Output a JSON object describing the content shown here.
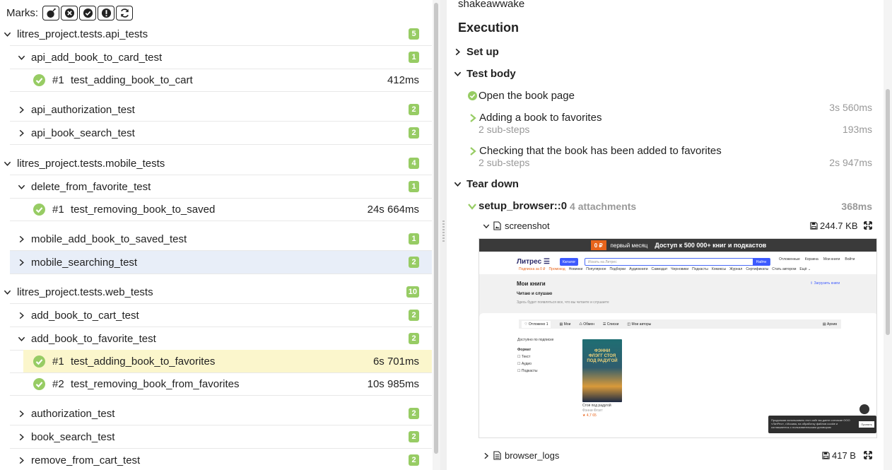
{
  "marks": {
    "label": "Marks:",
    "icons": [
      "bomb-icon",
      "x-circle-icon",
      "check-circle-icon",
      "exclamation-icon",
      "refresh-icon"
    ]
  },
  "tree": [
    {
      "kind": "group",
      "name": "litres_project.tests.api_tests",
      "count": "5",
      "expanded": true
    },
    {
      "kind": "suite",
      "name": "api_add_book_to_card_test",
      "count": "1",
      "expanded": true
    },
    {
      "kind": "case",
      "num": "#1",
      "name": "test_adding_book_to_cart",
      "duration": "412ms"
    },
    {
      "kind": "suite",
      "name": "api_authorization_test",
      "count": "2",
      "expanded": false
    },
    {
      "kind": "suite",
      "name": "api_book_search_test",
      "count": "2",
      "expanded": false
    },
    {
      "kind": "group",
      "name": "litres_project.tests.mobile_tests",
      "count": "4",
      "expanded": true
    },
    {
      "kind": "suite",
      "name": "delete_from_favorite_test",
      "count": "1",
      "expanded": true
    },
    {
      "kind": "case",
      "num": "#1",
      "name": "test_removing_book_to_saved",
      "duration": "24s 664ms"
    },
    {
      "kind": "suite",
      "name": "mobile_add_book_to_saved_test",
      "count": "1",
      "expanded": false
    },
    {
      "kind": "suite",
      "name": "mobile_searching_test",
      "count": "2",
      "expanded": false
    },
    {
      "kind": "group",
      "name": "litres_project.tests.web_tests",
      "count": "10",
      "expanded": true
    },
    {
      "kind": "suite",
      "name": "add_book_to_cart_test",
      "count": "2",
      "expanded": false
    },
    {
      "kind": "suite",
      "name": "add_book_to_favorite_test",
      "count": "2",
      "expanded": true
    },
    {
      "kind": "case",
      "num": "#1",
      "name": "test_adding_book_to_favorites",
      "duration": "6s 701ms"
    },
    {
      "kind": "case",
      "num": "#2",
      "name": "test_removing_book_from_favorites",
      "duration": "10s 985ms"
    },
    {
      "kind": "suite",
      "name": "authorization_test",
      "count": "2",
      "expanded": false
    },
    {
      "kind": "suite",
      "name": "book_search_test",
      "count": "2",
      "expanded": false
    },
    {
      "kind": "suite",
      "name": "remove_from_cart_test",
      "count": "2",
      "expanded": false
    }
  ],
  "detail": {
    "owner": "shakeawwake",
    "execution_title": "Execution",
    "setup_label": "Set up",
    "body_label": "Test body",
    "steps": [
      {
        "name": "Open the book page",
        "duration": "3s 560ms",
        "sub": ""
      },
      {
        "name": "Adding a book to favorites",
        "duration": "193ms",
        "sub": "2 sub-steps"
      },
      {
        "name": "Checking that the book has been added to favorites",
        "duration": "2s 947ms",
        "sub": "2 sub-steps"
      }
    ],
    "teardown_label": "Tear down",
    "fixture": {
      "name": "setup_browser::0",
      "attachments": "4 attachments",
      "duration": "368ms"
    },
    "attachments": [
      {
        "name": "screenshot",
        "size": "244.7 KB"
      },
      {
        "name": "browser_logs",
        "size": "417 B"
      }
    ]
  },
  "screenshot": {
    "banner_pill": "0 ₽",
    "banner_text": "первый месяц",
    "banner_big": "Доступ к 500 000+ книг и подкастов",
    "logo": "Литрес ☰",
    "catalog": "Каталог",
    "search_placeholder": "Искать на Литрес",
    "search_btn": "Найти",
    "user_icons": [
      "Отложенные",
      "Корзина",
      "Мои книги",
      "Войти"
    ],
    "menu_orange": [
      "Подписка за 0 ₽",
      "Промокод"
    ],
    "menu": [
      "Новинки",
      "Популярное",
      "Подборки",
      "Аудиокниги",
      "Самиздат",
      "Черновики",
      "Подкасты",
      "Комиксы",
      "Журнал",
      "Сертификаты",
      "Стать автором",
      "Ещё ⌄"
    ],
    "page_title": "Мои книги",
    "section": "Читаю и слушаю",
    "section_note": "Здесь будет появляться все, что вы читаете и слушаете",
    "upload": "⇪ Загрузить книги",
    "tabs": [
      "♡ Отложено 1",
      "▤ Мои",
      "♺ Обмен",
      "☰ Списки",
      "◫ Мои авторы"
    ],
    "archive": "▤ Архив",
    "filters": [
      "Доступно по подписке",
      "Формат",
      "☐ Текст",
      "☐ Аудио",
      "☐ Подкасты"
    ],
    "book_title_cover": "ФЭННИ ФЛЭГГ СТОЯ ПОД РАДУГОЙ",
    "book_caption": "Стоя под радугой",
    "book_author": "Фэнни Флэгг",
    "book_price": "★ 4,7  65",
    "cookie_text": "Продолжая использовать этот сайт вы даете согласие ООО «ЛитРес», г.Москва, на обработку файлов cookie и соглашаетесь с пользовательским договором",
    "cookie_ok": "Принять"
  }
}
